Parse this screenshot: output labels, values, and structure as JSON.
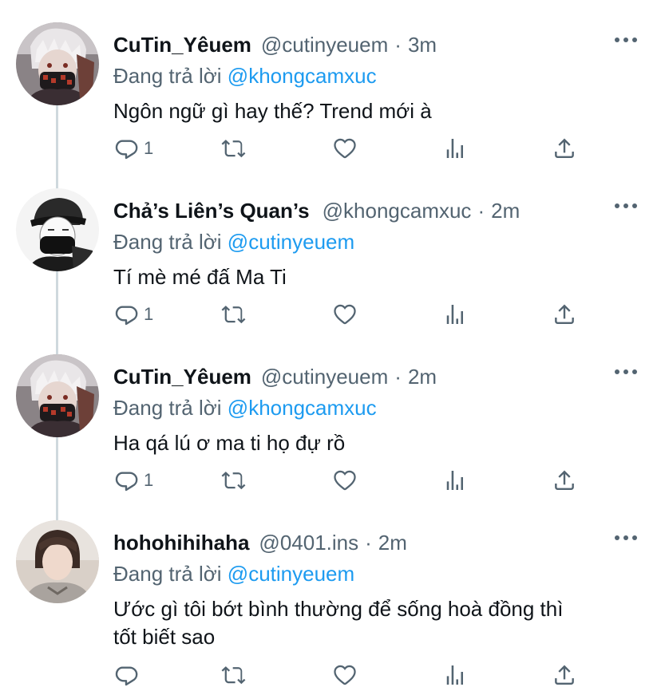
{
  "colors": {
    "accent": "#1d9bf0",
    "secondary_text": "#536471",
    "primary_text": "#0f1419",
    "thread_line": "#cfd9de"
  },
  "replies": [
    {
      "display_name": "CuTin_Yêuem",
      "handle": "@cutinyeuem",
      "separator": "·",
      "time": "3m",
      "reply_prefix": "Đang trả lời",
      "reply_mention": "@khongcamxuc",
      "text": "Ngôn ngữ gì hay thế? Trend mới à",
      "reply_count": "1",
      "avatar_icon": "anime-masked-boy-avatar"
    },
    {
      "display_name": "Chả’s Liên’s Quan’s",
      "handle": "@khongcamxuc",
      "separator": "·",
      "time": "2m",
      "reply_prefix": "Đang trả lời",
      "reply_mention": "@cutinyeuem",
      "text": "Tí mè mé đấ Ma Ti",
      "reply_count": "1",
      "avatar_icon": "bw-sketch-masked-boy-avatar"
    },
    {
      "display_name": "CuTin_Yêuem",
      "handle": "@cutinyeuem",
      "separator": "·",
      "time": "2m",
      "reply_prefix": "Đang trả lời",
      "reply_mention": "@khongcamxuc",
      "text": "Ha qá lú ơ ma ti họ đự rồ",
      "reply_count": "1",
      "avatar_icon": "anime-masked-boy-avatar"
    },
    {
      "display_name": "hohohihihaha",
      "handle": "@0401.ins",
      "separator": "·",
      "time": "2m",
      "reply_prefix": "Đang trả lời",
      "reply_mention": "@cutinyeuem",
      "text_line1": "Ước gì tôi bớt bình thường để sống hoà đồng thì",
      "text_line2": "tốt biết sao",
      "reply_count": "",
      "avatar_icon": "photo-person-avatar"
    }
  ],
  "icons": {
    "reply": "comment-icon",
    "retweet": "retweet-icon",
    "like": "heart-icon",
    "views": "analytics-icon",
    "share": "share-icon",
    "more": "more-dots-icon"
  }
}
